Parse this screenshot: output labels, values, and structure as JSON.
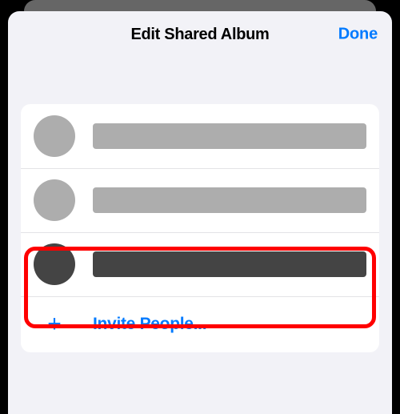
{
  "header": {
    "title": "Edit Shared Album",
    "done": "Done"
  },
  "people": [
    {
      "style": "light",
      "redacted": true
    },
    {
      "style": "light",
      "redacted": true
    },
    {
      "style": "dark",
      "redacted": true,
      "highlighted": true
    }
  ],
  "invite": {
    "label": "Invite People...",
    "icon": "+"
  }
}
